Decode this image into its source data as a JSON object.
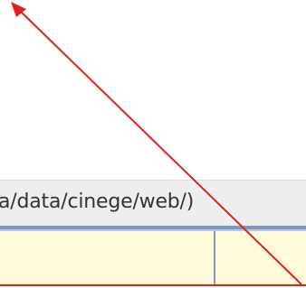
{
  "path_bar": {
    "text": "a/data/cinege/web/)"
  },
  "colors": {
    "annotation_red": "#e02020",
    "header_blue": "#7a98c4",
    "row_background": "#fffbd8"
  },
  "icons": {
    "arrow": "red-arrow-icon"
  }
}
